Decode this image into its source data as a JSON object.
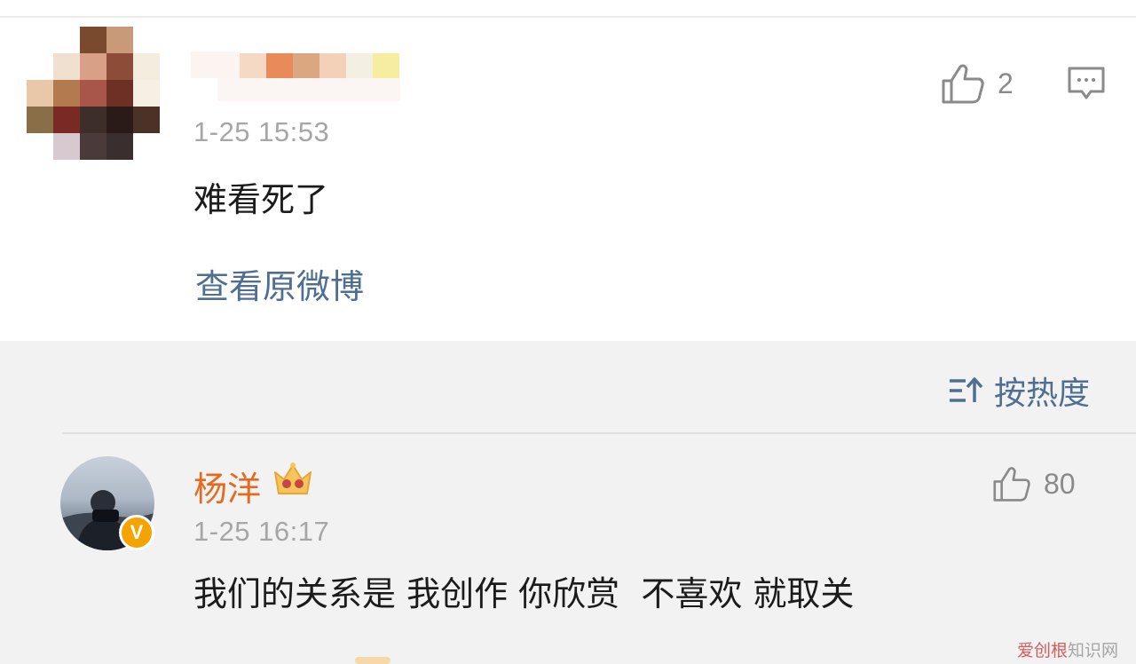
{
  "comment1": {
    "timestamp": "1-25 15:53",
    "text": "难看死了",
    "view_original_label": "查看原微博",
    "like_count": "2"
  },
  "sort": {
    "label": "按热度"
  },
  "comment2": {
    "username": "杨洋",
    "timestamp": "1-25 16:17",
    "text": "我们的关系是 我创作 你欣赏  不喜欢 就取关",
    "like_count": "80",
    "verified_label": "V"
  },
  "watermark": {
    "accent": "爱创根",
    "rest": "知识网"
  },
  "colors": {
    "link_blue": "#4e6e92",
    "username_orange": "#e46a1f",
    "muted_gray": "#a6a6a6",
    "verified_gold": "#f5a300"
  },
  "icons": {
    "like": "thumbs-up-icon",
    "reply": "comment-bubble-icon",
    "sort": "sort-icon",
    "crown": "crown-icon"
  }
}
